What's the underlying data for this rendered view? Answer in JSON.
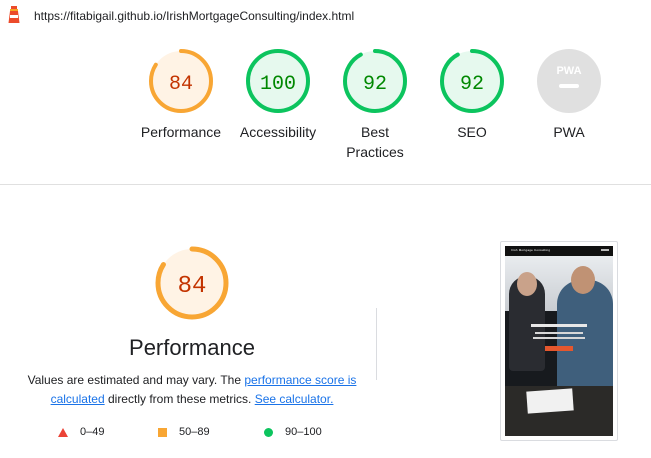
{
  "header": {
    "url": "https://fitabigail.github.io/IrishMortgageConsulting/index.html"
  },
  "gauges": [
    {
      "score": "84",
      "label": "Performance",
      "fraction": 0.84,
      "status": "average"
    },
    {
      "score": "100",
      "label": "Accessibility",
      "fraction": 1.0,
      "status": "pass"
    },
    {
      "score": "92",
      "label_line1": "Best",
      "label_line2": "Practices",
      "fraction": 0.92,
      "status": "pass"
    },
    {
      "score": "92",
      "label": "SEO",
      "fraction": 0.92,
      "status": "pass"
    },
    {
      "badge": "PWA",
      "label": "PWA",
      "status": "na"
    }
  ],
  "performance": {
    "score": "84",
    "fraction": 0.84,
    "title": "Performance",
    "desc_text1": "Values are estimated and may vary. The ",
    "desc_link1": "performance score is calculated",
    "desc_text2": " directly from these metrics. ",
    "desc_link2": "See calculator."
  },
  "legend": [
    {
      "range": "0–49",
      "shape": "triangle"
    },
    {
      "range": "50–89",
      "shape": "square"
    },
    {
      "range": "90–100",
      "shape": "circle"
    }
  ],
  "colors": {
    "average_fg": "#f8a634",
    "average_bg": "#fff3e5",
    "average_text": "#c33300",
    "pass_fg": "#0cc45e",
    "pass_bg": "#e6f9ee",
    "pass_text": "#008800",
    "fail": "#eb4336",
    "na": "#e0e0e0"
  },
  "screenshot": {
    "nav_title": "Irish Mortgage Consulting"
  }
}
